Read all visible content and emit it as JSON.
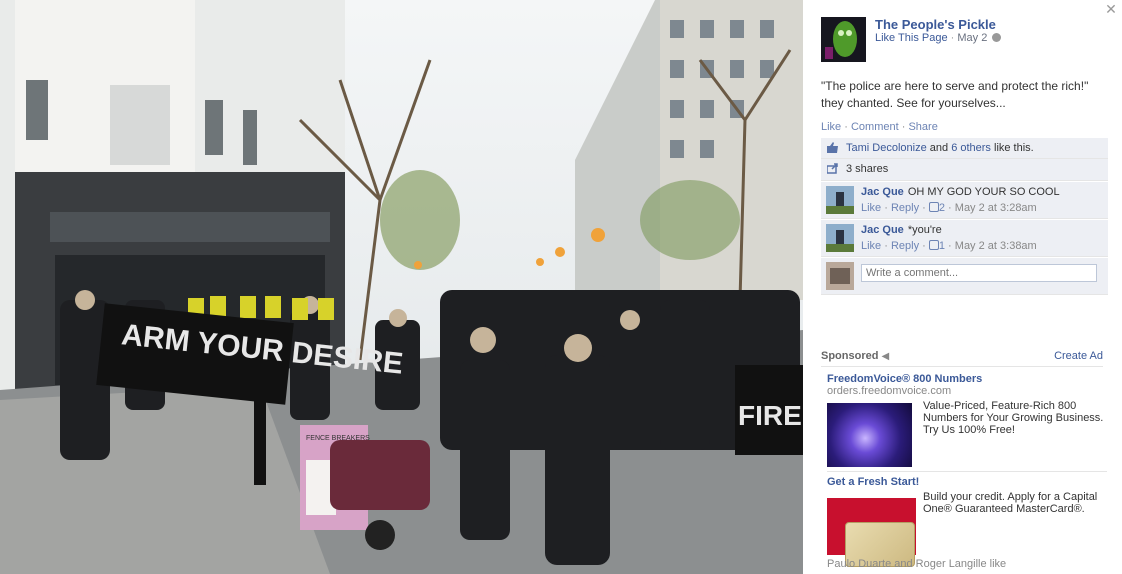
{
  "photo": {
    "banner_left": "ARM YOUR DESIRE",
    "banner_right": "FIRE",
    "placard": "FENCE BREAKERS"
  },
  "page": {
    "name": "The People's Pickle",
    "like_link": "Like This Page",
    "date": "May 2"
  },
  "caption": "\"The police are here to serve and protect the rich!\" they chanted. See for yourselves...",
  "actions": {
    "like": "Like",
    "comment": "Comment",
    "share": "Share",
    "sep": "·"
  },
  "likes": {
    "person": "Tami Decolonize",
    "and": "and",
    "others": "6 others",
    "suffix": "like this."
  },
  "shares": "3 shares",
  "comments": [
    {
      "name": "Jac Que",
      "text": "OH MY GOD YOUR SO COOL",
      "like": "Like",
      "reply": "Reply",
      "likes": "2",
      "time": "May 2 at 3:28am"
    },
    {
      "name": "Jac Que",
      "text": "*you're",
      "like": "Like",
      "reply": "Reply",
      "likes": "1",
      "time": "May 2 at 3:38am"
    }
  ],
  "write_comment": {
    "placeholder": "Write a comment..."
  },
  "sponsored": {
    "label": "Sponsored",
    "create_ad": "Create Ad"
  },
  "ads": [
    {
      "title": "FreedomVoice® 800 Numbers",
      "url": "orders.freedomvoice.com",
      "body": "Value-Priced, Feature-Rich 800 Numbers for Your Growing Business. Try Us 100% Free!"
    },
    {
      "title": "Get a Fresh Start!",
      "body": "Build your credit. Apply for a Capital One® Guaranteed MasterCard®.",
      "social": "Paulo Duarte and Roger Langille like"
    }
  ],
  "colors": {
    "link": "#3b5998",
    "ufi_bg": "#edeff4"
  }
}
